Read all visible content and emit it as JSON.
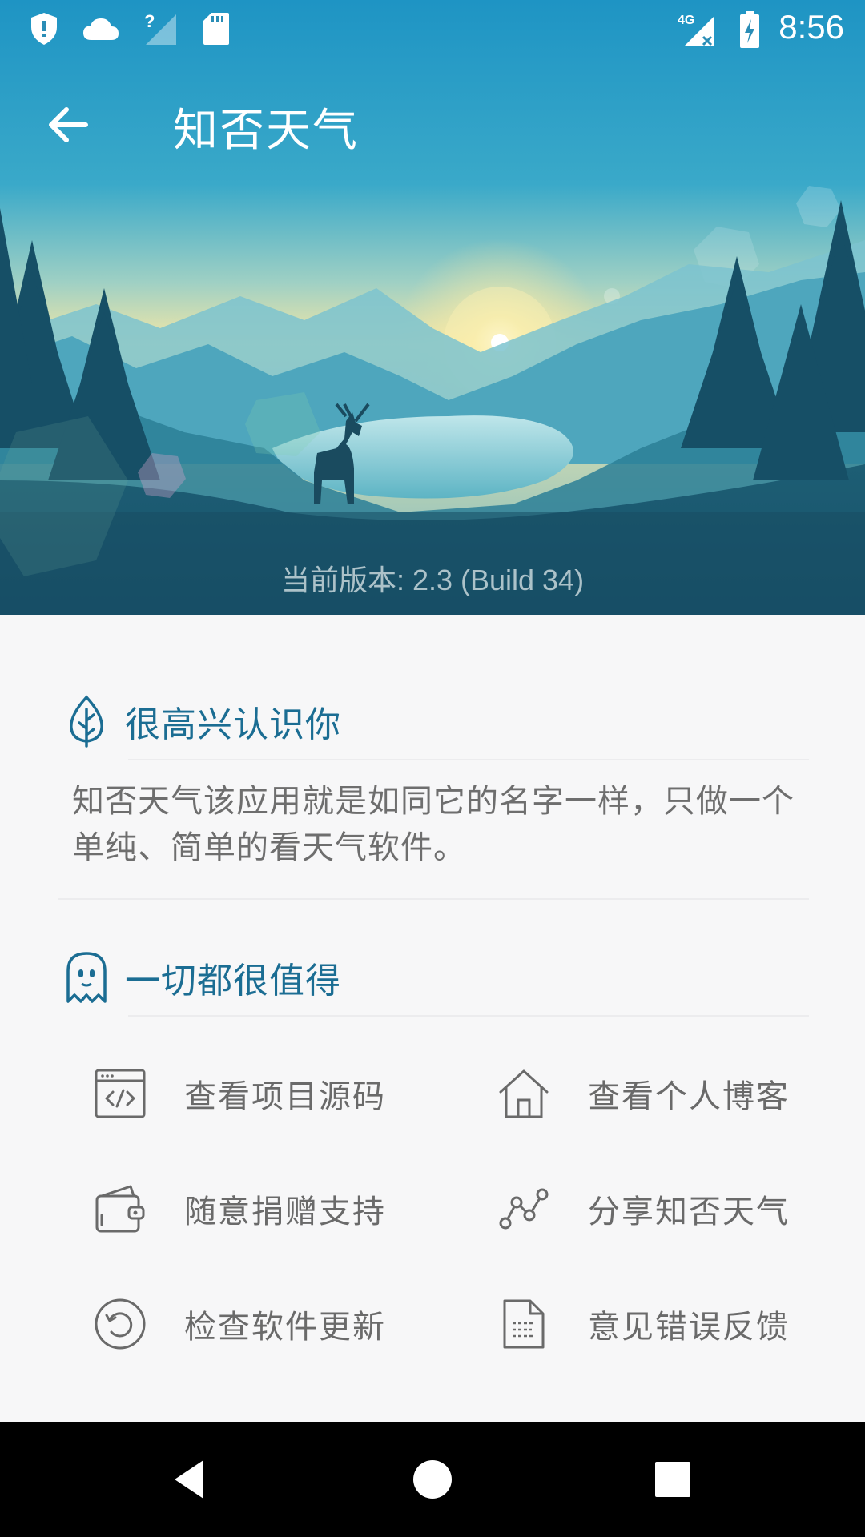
{
  "status_bar": {
    "time": "8:56",
    "network": "4G",
    "icons": [
      "shield-alert-icon",
      "cloud-icon",
      "signal-unknown-icon",
      "sd-card-icon",
      "mobile-data-off-icon",
      "battery-charging-icon"
    ]
  },
  "toolbar": {
    "title": "知否天气",
    "back_icon": "arrow-back-icon"
  },
  "hero": {
    "version_text": "当前版本: 2.3 (Build 34)"
  },
  "intro_section": {
    "title": "很高兴认识你",
    "icon": "leaf-icon",
    "text": "知否天气该应用就是如同它的名字一样，只做一个单纯、简单的看天气软件。"
  },
  "links_section": {
    "title": "一切都很值得",
    "icon": "ghost-icon",
    "items": [
      {
        "label": "查看项目源码",
        "icon": "code-window-icon"
      },
      {
        "label": "查看个人博客",
        "icon": "home-icon"
      },
      {
        "label": "随意捐赠支持",
        "icon": "wallet-icon"
      },
      {
        "label": "分享知否天气",
        "icon": "share-graph-icon"
      },
      {
        "label": "检查软件更新",
        "icon": "refresh-circle-icon"
      },
      {
        "label": "意见错误反馈",
        "icon": "document-icon"
      }
    ]
  },
  "nav_bar": {
    "buttons": [
      "back-triangle-icon",
      "home-circle-icon",
      "recents-square-icon"
    ]
  },
  "colors": {
    "accent": "#1b6d93",
    "text_secondary": "#6a6a6a",
    "background": "#f7f7f8",
    "navbar": "#000000"
  }
}
